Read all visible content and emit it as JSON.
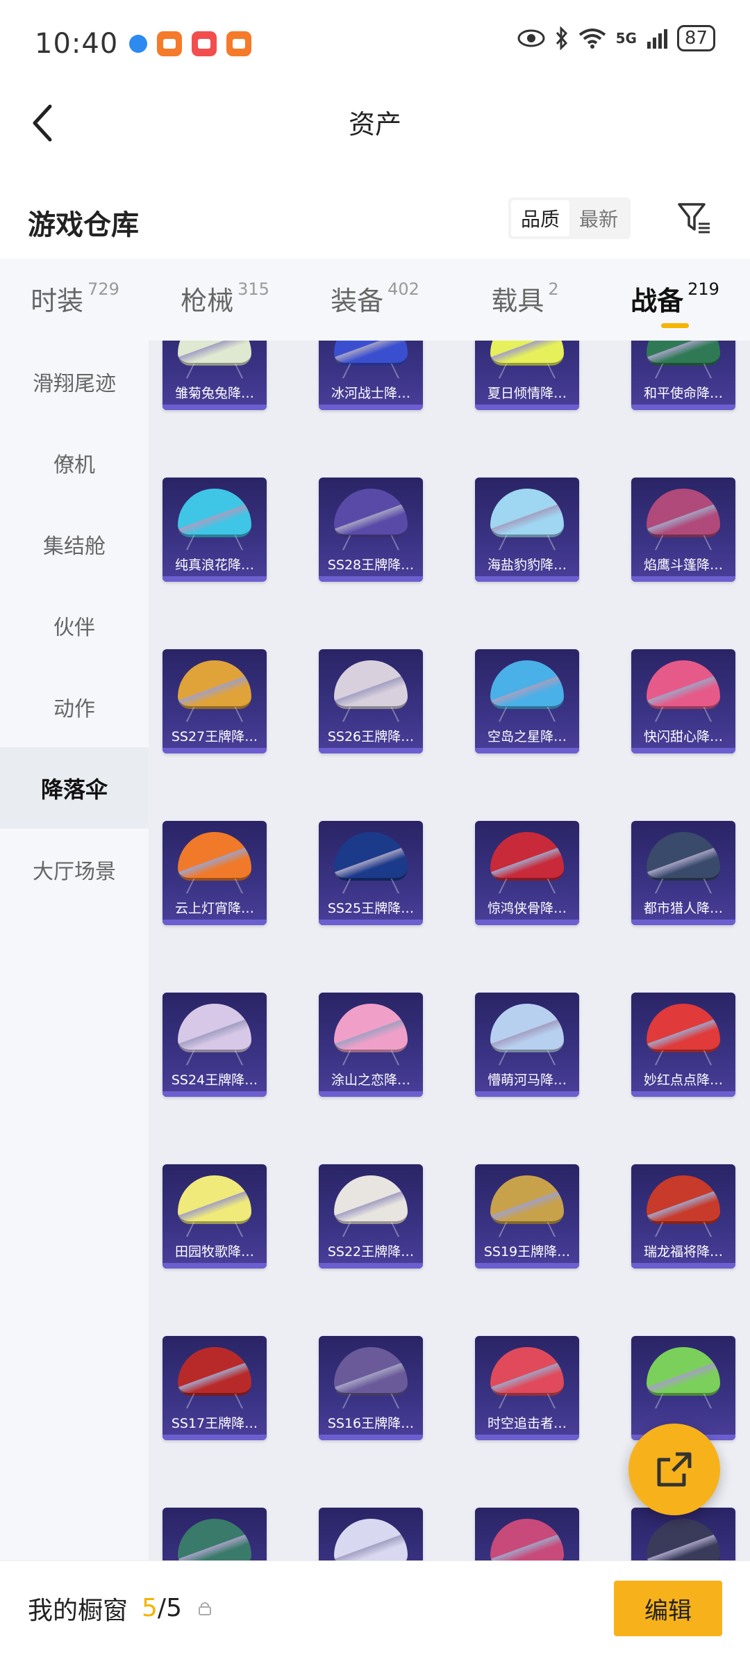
{
  "status": {
    "time": "10:40",
    "network": "5G",
    "battery": "87"
  },
  "nav": {
    "title": "资产"
  },
  "warehouse": {
    "title": "游戏仓库",
    "sort_options": [
      "品质",
      "最新"
    ],
    "sort_selected": "品质"
  },
  "tabs": [
    {
      "label": "时装",
      "count": "729"
    },
    {
      "label": "枪械",
      "count": "315"
    },
    {
      "label": "装备",
      "count": "402"
    },
    {
      "label": "载具",
      "count": "2"
    },
    {
      "label": "战备",
      "count": "219"
    }
  ],
  "active_tab": "战备",
  "sidebar": [
    {
      "label": "滑翔尾迹"
    },
    {
      "label": "僚机"
    },
    {
      "label": "集结舱"
    },
    {
      "label": "伙伴"
    },
    {
      "label": "动作"
    },
    {
      "label": "降落伞"
    },
    {
      "label": "大厅场景"
    }
  ],
  "active_sidebar": "降落伞",
  "items": [
    {
      "name": "雏菊兔兔降…",
      "color": "#dfe8d0"
    },
    {
      "name": "冰河战士降…",
      "color": "#3a4fd0"
    },
    {
      "name": "夏日倾情降…",
      "color": "#e6f05a"
    },
    {
      "name": "和平使命降…",
      "color": "#2f7a55"
    },
    {
      "name": "纯真浪花降…",
      "color": "#3fc6e6"
    },
    {
      "name": "SS28王牌降…",
      "color": "#5a4aa8"
    },
    {
      "name": "海盐豹豹降…",
      "color": "#9fd6f2"
    },
    {
      "name": "焰鹰斗篷降…",
      "color": "#b04a7a"
    },
    {
      "name": "SS27王牌降…",
      "color": "#e0a33a"
    },
    {
      "name": "SS26王牌降…",
      "color": "#d8d0dc"
    },
    {
      "name": "空岛之星降…",
      "color": "#4ab0e8"
    },
    {
      "name": "快闪甜心降…",
      "color": "#e65a8a"
    },
    {
      "name": "云上灯宵降…",
      "color": "#f07a2a"
    },
    {
      "name": "SS25王牌降…",
      "color": "#1c3a8a"
    },
    {
      "name": "惊鸿侠骨降…",
      "color": "#c82a3a"
    },
    {
      "name": "都市猎人降…",
      "color": "#3a4a6a"
    },
    {
      "name": "SS24王牌降…",
      "color": "#d8c8e8"
    },
    {
      "name": "涂山之恋降…",
      "color": "#f0a0c8"
    },
    {
      "name": "懵萌河马降…",
      "color": "#b8d0f0"
    },
    {
      "name": "妙红点点降…",
      "color": "#e03a3a"
    },
    {
      "name": "田园牧歌降…",
      "color": "#f0ea7a"
    },
    {
      "name": "SS22王牌降…",
      "color": "#e8e4e0"
    },
    {
      "name": "SS19王牌降…",
      "color": "#c8a24a"
    },
    {
      "name": "瑞龙福将降…",
      "color": "#c83a2a"
    },
    {
      "name": "SS17王牌降…",
      "color": "#b82a2a"
    },
    {
      "name": "SS16王牌降…",
      "color": "#6a5a9a"
    },
    {
      "name": "时空追击者…",
      "color": "#e04a5a"
    },
    {
      "name": "",
      "color": "#7ad05a"
    },
    {
      "name": "",
      "color": "#3a7a6a"
    },
    {
      "name": "",
      "color": "#d8d8f0"
    },
    {
      "name": "",
      "color": "#c84a7a"
    },
    {
      "name": "",
      "color": "#3a3a5a"
    }
  ],
  "bottom": {
    "label": "我的橱窗",
    "count_current": "5",
    "count_sep": "/",
    "count_total": "5",
    "edit_label": "编辑"
  },
  "icons": {
    "back": "chevron-left-icon",
    "filter": "filter-icon",
    "share": "share-icon",
    "lock": "lock-icon"
  }
}
